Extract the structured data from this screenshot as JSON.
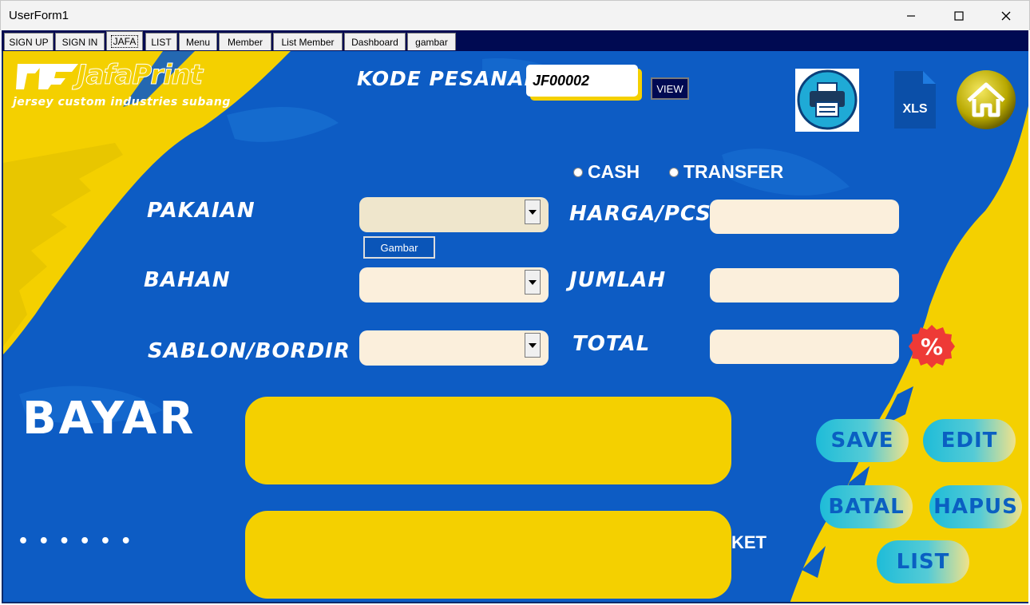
{
  "window": {
    "title": "UserForm1"
  },
  "tabs": [
    {
      "label": "SIGN UP"
    },
    {
      "label": "SIGN IN"
    },
    {
      "label": "JAFA",
      "active": true
    },
    {
      "label": "LIST"
    },
    {
      "label": "Menu"
    },
    {
      "label": "Member"
    },
    {
      "label": "List Member"
    },
    {
      "label": "Dashboard"
    },
    {
      "label": "gambar"
    }
  ],
  "header": {
    "logo_text": "JafaPrint",
    "logo_tagline": "jersey custom industries subang",
    "kode_pesanan_label": "KODE PESANAN",
    "kode_pesanan_value": "JF00002",
    "view_label": "VIEW",
    "icons": [
      "printer-icon",
      "xls-icon",
      "home-icon"
    ],
    "xls_label": "XLS"
  },
  "payment": {
    "options": [
      {
        "label": "CASH",
        "selected": false
      },
      {
        "label": "TRANSFER",
        "selected": false
      }
    ]
  },
  "form": {
    "pakaian_label": "PAKAIAN",
    "pakaian_value": "",
    "gambar_label": "Gambar",
    "bahan_label": "BAHAN",
    "bahan_value": "",
    "sablon_label": "SABLON/BORDIR",
    "sablon_value": "",
    "harga_label": "HARGA/PCS",
    "harga_value": "",
    "jumlah_label": "JUMLAH",
    "jumlah_value": "",
    "total_label": "TOTAL",
    "total_value": "",
    "discount_symbol": "%"
  },
  "bottom": {
    "bayar_label": "BAYAR",
    "bayar_value": "",
    "dots_label": "• • • • • •",
    "ket_label": "KET",
    "ket_value": ""
  },
  "actions": {
    "save": "SAVE",
    "edit": "EDIT",
    "batal": "BATAL",
    "hapus": "HAPUS",
    "list": "LIST"
  },
  "colors": {
    "form_blue": "#0d5cc4",
    "brand_yellow": "#f4d000",
    "tab_strip_navy": "#000a52",
    "field_cream": "#fbefdc",
    "button_text": "#0a5fc2"
  }
}
